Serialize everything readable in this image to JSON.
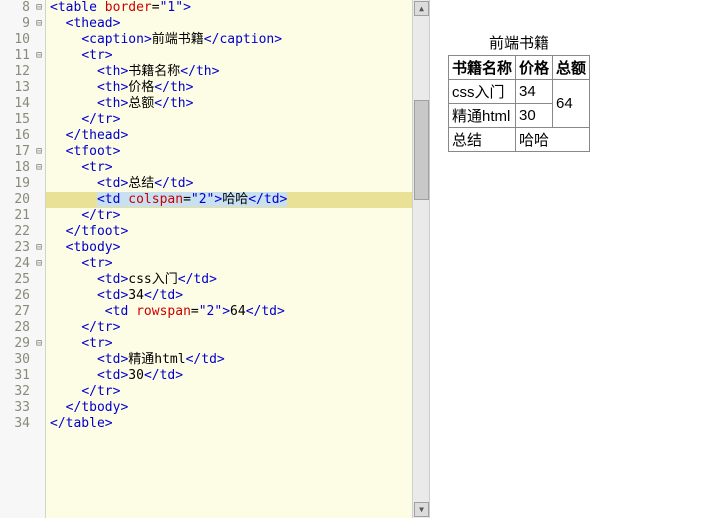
{
  "lines": [
    {
      "n": "8",
      "f": "⊟",
      "indent": 0,
      "tokens": [
        {
          "t": "<",
          "c": "angle"
        },
        {
          "t": "table",
          "c": "tag"
        },
        {
          "t": " ",
          "c": "txt"
        },
        {
          "t": "border",
          "c": "attr"
        },
        {
          "t": "=",
          "c": "txt"
        },
        {
          "t": "\"1\"",
          "c": "val"
        },
        {
          "t": ">",
          "c": "angle"
        }
      ]
    },
    {
      "n": "9",
      "f": "⊟",
      "indent": 1,
      "tokens": [
        {
          "t": "<",
          "c": "angle"
        },
        {
          "t": "thead",
          "c": "tag"
        },
        {
          "t": ">",
          "c": "angle"
        }
      ]
    },
    {
      "n": "10",
      "f": "",
      "indent": 2,
      "tokens": [
        {
          "t": "<",
          "c": "angle"
        },
        {
          "t": "caption",
          "c": "tag"
        },
        {
          "t": ">",
          "c": "angle"
        },
        {
          "t": "前端书籍",
          "c": "txt"
        },
        {
          "t": "</",
          "c": "angle"
        },
        {
          "t": "caption",
          "c": "tag"
        },
        {
          "t": ">",
          "c": "angle"
        }
      ]
    },
    {
      "n": "11",
      "f": "⊟",
      "indent": 2,
      "tokens": [
        {
          "t": "<",
          "c": "angle"
        },
        {
          "t": "tr",
          "c": "tag"
        },
        {
          "t": ">",
          "c": "angle"
        }
      ]
    },
    {
      "n": "12",
      "f": "",
      "indent": 3,
      "tokens": [
        {
          "t": "<",
          "c": "angle"
        },
        {
          "t": "th",
          "c": "tag"
        },
        {
          "t": ">",
          "c": "angle"
        },
        {
          "t": "书籍名称",
          "c": "txt"
        },
        {
          "t": "</",
          "c": "angle"
        },
        {
          "t": "th",
          "c": "tag"
        },
        {
          "t": ">",
          "c": "angle"
        }
      ]
    },
    {
      "n": "13",
      "f": "",
      "indent": 3,
      "tokens": [
        {
          "t": "<",
          "c": "angle"
        },
        {
          "t": "th",
          "c": "tag"
        },
        {
          "t": ">",
          "c": "angle"
        },
        {
          "t": "价格",
          "c": "txt"
        },
        {
          "t": "</",
          "c": "angle"
        },
        {
          "t": "th",
          "c": "tag"
        },
        {
          "t": ">",
          "c": "angle"
        }
      ]
    },
    {
      "n": "14",
      "f": "",
      "indent": 3,
      "tokens": [
        {
          "t": "<",
          "c": "angle"
        },
        {
          "t": "th",
          "c": "tag"
        },
        {
          "t": ">",
          "c": "angle"
        },
        {
          "t": "总额",
          "c": "txt"
        },
        {
          "t": "</",
          "c": "angle"
        },
        {
          "t": "th",
          "c": "tag"
        },
        {
          "t": ">",
          "c": "angle"
        }
      ]
    },
    {
      "n": "15",
      "f": "",
      "indent": 2,
      "tokens": [
        {
          "t": "</",
          "c": "angle"
        },
        {
          "t": "tr",
          "c": "tag"
        },
        {
          "t": ">",
          "c": "angle"
        }
      ]
    },
    {
      "n": "16",
      "f": "",
      "indent": 1,
      "tokens": [
        {
          "t": "</",
          "c": "angle"
        },
        {
          "t": "thead",
          "c": "tag"
        },
        {
          "t": ">",
          "c": "angle"
        }
      ]
    },
    {
      "n": "17",
      "f": "⊟",
      "indent": 1,
      "tokens": [
        {
          "t": "<",
          "c": "angle"
        },
        {
          "t": "tfoot",
          "c": "tag"
        },
        {
          "t": ">",
          "c": "angle"
        }
      ]
    },
    {
      "n": "18",
      "f": "⊟",
      "indent": 2,
      "tokens": [
        {
          "t": "<",
          "c": "angle"
        },
        {
          "t": "tr",
          "c": "tag"
        },
        {
          "t": ">",
          "c": "angle"
        }
      ]
    },
    {
      "n": "19",
      "f": "",
      "indent": 3,
      "tokens": [
        {
          "t": "<",
          "c": "angle"
        },
        {
          "t": "td",
          "c": "tag"
        },
        {
          "t": ">",
          "c": "angle"
        },
        {
          "t": "总结",
          "c": "txt"
        },
        {
          "t": "</",
          "c": "angle"
        },
        {
          "t": "td",
          "c": "tag"
        },
        {
          "t": ">",
          "c": "angle"
        }
      ]
    },
    {
      "n": "20",
      "f": "",
      "indent": 3,
      "hl": true,
      "tokens": [
        {
          "t": "<",
          "c": "angle",
          "sel": true
        },
        {
          "t": "td",
          "c": "tag",
          "sel": true
        },
        {
          "t": " ",
          "c": "txt",
          "sel": true
        },
        {
          "t": "colspan",
          "c": "attr",
          "sel": true
        },
        {
          "t": "=",
          "c": "txt",
          "sel": true
        },
        {
          "t": "\"2\"",
          "c": "val",
          "sel": true
        },
        {
          "t": ">",
          "c": "angle",
          "sel": true
        },
        {
          "t": "哈哈",
          "c": "txt",
          "sel": true
        },
        {
          "t": "</",
          "c": "angle",
          "sel": true
        },
        {
          "t": "td",
          "c": "tag",
          "sel": true
        },
        {
          "t": ">",
          "c": "angle",
          "sel": true
        }
      ]
    },
    {
      "n": "21",
      "f": "",
      "indent": 2,
      "tokens": [
        {
          "t": "</",
          "c": "angle"
        },
        {
          "t": "tr",
          "c": "tag"
        },
        {
          "t": ">",
          "c": "angle"
        }
      ]
    },
    {
      "n": "22",
      "f": "",
      "indent": 1,
      "tokens": [
        {
          "t": "</",
          "c": "angle"
        },
        {
          "t": "tfoot",
          "c": "tag"
        },
        {
          "t": ">",
          "c": "angle"
        }
      ]
    },
    {
      "n": "23",
      "f": "⊟",
      "indent": 1,
      "tokens": [
        {
          "t": "<",
          "c": "angle"
        },
        {
          "t": "tbody",
          "c": "tag"
        },
        {
          "t": ">",
          "c": "angle"
        }
      ]
    },
    {
      "n": "24",
      "f": "⊟",
      "indent": 2,
      "tokens": [
        {
          "t": "<",
          "c": "angle"
        },
        {
          "t": "tr",
          "c": "tag"
        },
        {
          "t": ">",
          "c": "angle"
        }
      ]
    },
    {
      "n": "25",
      "f": "",
      "indent": 3,
      "tokens": [
        {
          "t": "<",
          "c": "angle"
        },
        {
          "t": "td",
          "c": "tag"
        },
        {
          "t": ">",
          "c": "angle"
        },
        {
          "t": "css入门",
          "c": "txt"
        },
        {
          "t": "</",
          "c": "angle"
        },
        {
          "t": "td",
          "c": "tag"
        },
        {
          "t": ">",
          "c": "angle"
        }
      ]
    },
    {
      "n": "26",
      "f": "",
      "indent": 3,
      "tokens": [
        {
          "t": "<",
          "c": "angle"
        },
        {
          "t": "td",
          "c": "tag"
        },
        {
          "t": ">",
          "c": "angle"
        },
        {
          "t": "34",
          "c": "txt"
        },
        {
          "t": "</",
          "c": "angle"
        },
        {
          "t": "td",
          "c": "tag"
        },
        {
          "t": ">",
          "c": "angle"
        }
      ]
    },
    {
      "n": "27",
      "f": "",
      "indent": 3,
      "tokens": [
        {
          "t": " <",
          "c": "angle"
        },
        {
          "t": "td",
          "c": "tag"
        },
        {
          "t": " ",
          "c": "txt"
        },
        {
          "t": "rowspan",
          "c": "attr"
        },
        {
          "t": "=",
          "c": "txt"
        },
        {
          "t": "\"2\"",
          "c": "val"
        },
        {
          "t": ">",
          "c": "angle"
        },
        {
          "t": "64",
          "c": "txt"
        },
        {
          "t": "</",
          "c": "angle"
        },
        {
          "t": "td",
          "c": "tag"
        },
        {
          "t": ">",
          "c": "angle"
        }
      ]
    },
    {
      "n": "28",
      "f": "",
      "indent": 2,
      "tokens": [
        {
          "t": "</",
          "c": "angle"
        },
        {
          "t": "tr",
          "c": "tag"
        },
        {
          "t": ">",
          "c": "angle"
        }
      ]
    },
    {
      "n": "29",
      "f": "⊟",
      "indent": 2,
      "tokens": [
        {
          "t": "<",
          "c": "angle"
        },
        {
          "t": "tr",
          "c": "tag"
        },
        {
          "t": ">",
          "c": "angle"
        }
      ]
    },
    {
      "n": "30",
      "f": "",
      "indent": 3,
      "tokens": [
        {
          "t": "<",
          "c": "angle"
        },
        {
          "t": "td",
          "c": "tag"
        },
        {
          "t": ">",
          "c": "angle"
        },
        {
          "t": "精通html",
          "c": "txt"
        },
        {
          "t": "</",
          "c": "angle"
        },
        {
          "t": "td",
          "c": "tag"
        },
        {
          "t": ">",
          "c": "angle"
        }
      ]
    },
    {
      "n": "31",
      "f": "",
      "indent": 3,
      "tokens": [
        {
          "t": "<",
          "c": "angle"
        },
        {
          "t": "td",
          "c": "tag"
        },
        {
          "t": ">",
          "c": "angle"
        },
        {
          "t": "30",
          "c": "txt"
        },
        {
          "t": "</",
          "c": "angle"
        },
        {
          "t": "td",
          "c": "tag"
        },
        {
          "t": ">",
          "c": "angle"
        }
      ]
    },
    {
      "n": "32",
      "f": "",
      "indent": 2,
      "tokens": [
        {
          "t": "</",
          "c": "angle"
        },
        {
          "t": "tr",
          "c": "tag"
        },
        {
          "t": ">",
          "c": "angle"
        }
      ]
    },
    {
      "n": "33",
      "f": "",
      "indent": 1,
      "tokens": [
        {
          "t": "</",
          "c": "angle"
        },
        {
          "t": "tbody",
          "c": "tag"
        },
        {
          "t": ">",
          "c": "angle"
        }
      ]
    },
    {
      "n": "34",
      "f": "",
      "indent": 0,
      "tokens": [
        {
          "t": "</",
          "c": "angle"
        },
        {
          "t": "table",
          "c": "tag"
        },
        {
          "t": ">",
          "c": "angle"
        }
      ]
    }
  ],
  "preview": {
    "caption": "前端书籍",
    "h1": "书籍名称",
    "h2": "价格",
    "h3": "总额",
    "r1c1": "css入门",
    "r1c2": "34",
    "r1c3": "64",
    "r2c1_pre": "精通",
    "r2c1_html": "html",
    "r2c2": "30",
    "f1": "总结",
    "f2": "哈哈"
  }
}
